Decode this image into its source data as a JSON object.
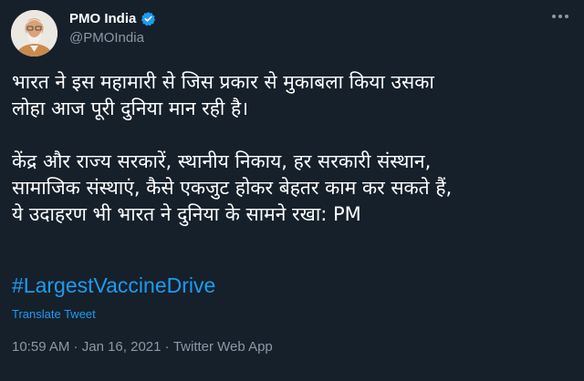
{
  "author": {
    "display_name": "PMO India",
    "handle": "@PMOIndia",
    "verified_icon": "verified-badge-icon",
    "avatar_alt": "profile photo"
  },
  "more_icon": "more-options-icon",
  "tweet": {
    "paragraph1": [
      "भारत ने इस महामारी से जिस प्रकार से मुकाबला किया उसका",
      "लोहा आज पूरी दुनिया मान रही है।"
    ],
    "paragraph2": [
      "केंद्र और राज्य सरकारें, स्थानीय निकाय, हर सरकारी संस्थान,",
      "सामाजिक संस्थाएं, कैसे एकजुट होकर बेहतर काम कर सकते हैं,",
      "ये उदाहरण भी भारत ने दुनिया के सामने रखा: PM"
    ],
    "hashtag": "#LargestVaccineDrive",
    "translate_label": "Translate Tweet"
  },
  "meta": {
    "time": "10:59 AM",
    "separator": " · ",
    "date": "Jan 16, 2021",
    "source": "Twitter Web App"
  },
  "colors": {
    "background": "#15202b",
    "link": "#1d9bf0",
    "secondary_text": "#8b98a5"
  }
}
